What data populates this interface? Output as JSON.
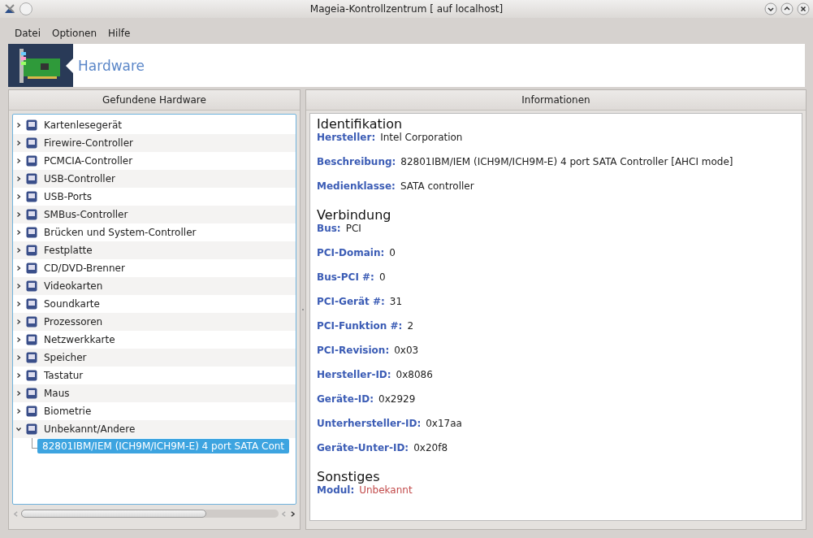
{
  "window": {
    "title": "Mageia-Kontrollzentrum  [ auf localhost]"
  },
  "menu": [
    {
      "label": "Datei"
    },
    {
      "label": "Optionen"
    },
    {
      "label": "Hilfe"
    }
  ],
  "banner": {
    "title": "Hardware"
  },
  "left_pane": {
    "header": "Gefundene Hardware",
    "tree": [
      {
        "label": "Kartenlesegerät",
        "expanded": false,
        "selected": false
      },
      {
        "label": "Firewire-Controller",
        "expanded": false,
        "selected": false
      },
      {
        "label": "PCMCIA-Controller",
        "expanded": false,
        "selected": false
      },
      {
        "label": "USB-Controller",
        "expanded": false,
        "selected": false
      },
      {
        "label": "USB-Ports",
        "expanded": false,
        "selected": false
      },
      {
        "label": "SMBus-Controller",
        "expanded": false,
        "selected": false
      },
      {
        "label": "Brücken und System-Controller",
        "expanded": false,
        "selected": false
      },
      {
        "label": "Festplatte",
        "expanded": false,
        "selected": false
      },
      {
        "label": "CD/DVD-Brenner",
        "expanded": false,
        "selected": false
      },
      {
        "label": "Videokarten",
        "expanded": false,
        "selected": false
      },
      {
        "label": "Soundkarte",
        "expanded": false,
        "selected": false
      },
      {
        "label": "Prozessoren",
        "expanded": false,
        "selected": false
      },
      {
        "label": "Netzwerkkarte",
        "expanded": false,
        "selected": false
      },
      {
        "label": "Speicher",
        "expanded": false,
        "selected": false
      },
      {
        "label": "Tastatur",
        "expanded": false,
        "selected": false
      },
      {
        "label": "Maus",
        "expanded": false,
        "selected": false
      },
      {
        "label": "Biometrie",
        "expanded": false,
        "selected": false
      },
      {
        "label": "Unbekannt/Andere",
        "expanded": true,
        "selected": false,
        "children": [
          {
            "label": "82801IBM/IEM (ICH9M/ICH9M-E) 4 port SATA Cont",
            "selected": true
          }
        ]
      }
    ]
  },
  "right_pane": {
    "header": "Informationen",
    "sections": [
      {
        "title": "Identifikation",
        "fields": [
          {
            "label": "Hersteller:",
            "value": "Intel Corporation",
            "kind": "normal"
          },
          {
            "label": "Beschreibung:",
            "value": "82801IBM/IEM (ICH9M/ICH9M-E) 4 port SATA Controller [AHCI mode]",
            "kind": "normal"
          },
          {
            "label": "Medienklasse:",
            "value": "SATA controller",
            "kind": "normal"
          }
        ]
      },
      {
        "title": "Verbindung",
        "fields": [
          {
            "label": "Bus:",
            "value": "PCI",
            "kind": "normal"
          },
          {
            "label": "PCI-Domain:",
            "value": "0",
            "kind": "normal"
          },
          {
            "label": "Bus-PCI #:",
            "value": "0",
            "kind": "normal"
          },
          {
            "label": "PCI-Gerät #:",
            "value": "31",
            "kind": "normal"
          },
          {
            "label": "PCI-Funktion #:",
            "value": "2",
            "kind": "normal"
          },
          {
            "label": "PCI-Revision:",
            "value": "0x03",
            "kind": "normal"
          },
          {
            "label": "Hersteller-ID:",
            "value": "0x8086",
            "kind": "normal"
          },
          {
            "label": "Geräte-ID:",
            "value": "0x2929",
            "kind": "normal"
          },
          {
            "label": "Unterhersteller-ID:",
            "value": "0x17aa",
            "kind": "normal"
          },
          {
            "label": "Geräte-Unter-ID:",
            "value": "0x20f8",
            "kind": "normal"
          }
        ]
      },
      {
        "title": "Sonstiges",
        "fields": [
          {
            "label": "Modul:",
            "value": "Unbekannt",
            "kind": "warning"
          }
        ]
      }
    ]
  }
}
